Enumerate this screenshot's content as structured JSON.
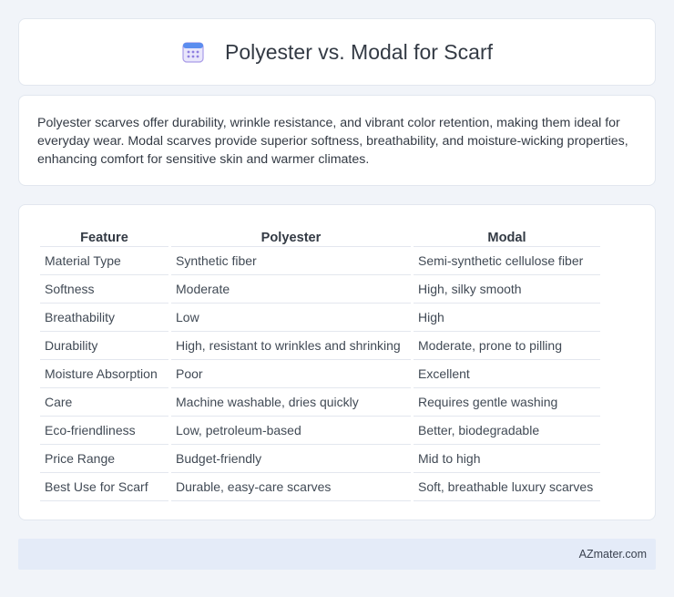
{
  "header": {
    "title": "Polyester vs. Modal for Scarf",
    "icon": "calendar-icon"
  },
  "intro": {
    "text": "Polyester scarves offer durability, wrinkle resistance, and vibrant color retention, making them ideal for everyday wear. Modal scarves provide superior softness, breathability, and moisture-wicking properties, enhancing comfort for sensitive skin and warmer climates."
  },
  "table": {
    "headers": [
      "Feature",
      "Polyester",
      "Modal"
    ],
    "rows": [
      [
        "Material Type",
        "Synthetic fiber",
        "Semi-synthetic cellulose fiber"
      ],
      [
        "Softness",
        "Moderate",
        "High, silky smooth"
      ],
      [
        "Breathability",
        "Low",
        "High"
      ],
      [
        "Durability",
        "High, resistant to wrinkles and shrinking",
        "Moderate, prone to pilling"
      ],
      [
        "Moisture Absorption",
        "Poor",
        "Excellent"
      ],
      [
        "Care",
        "Machine washable, dries quickly",
        "Requires gentle washing"
      ],
      [
        "Eco-friendliness",
        "Low, petroleum-based",
        "Better, biodegradable"
      ],
      [
        "Price Range",
        "Budget-friendly",
        "Mid to high"
      ],
      [
        "Best Use for Scarf",
        "Durable, easy-care scarves",
        "Soft, breathable luxury scarves"
      ]
    ]
  },
  "footer": {
    "text": "AZmater.com"
  }
}
